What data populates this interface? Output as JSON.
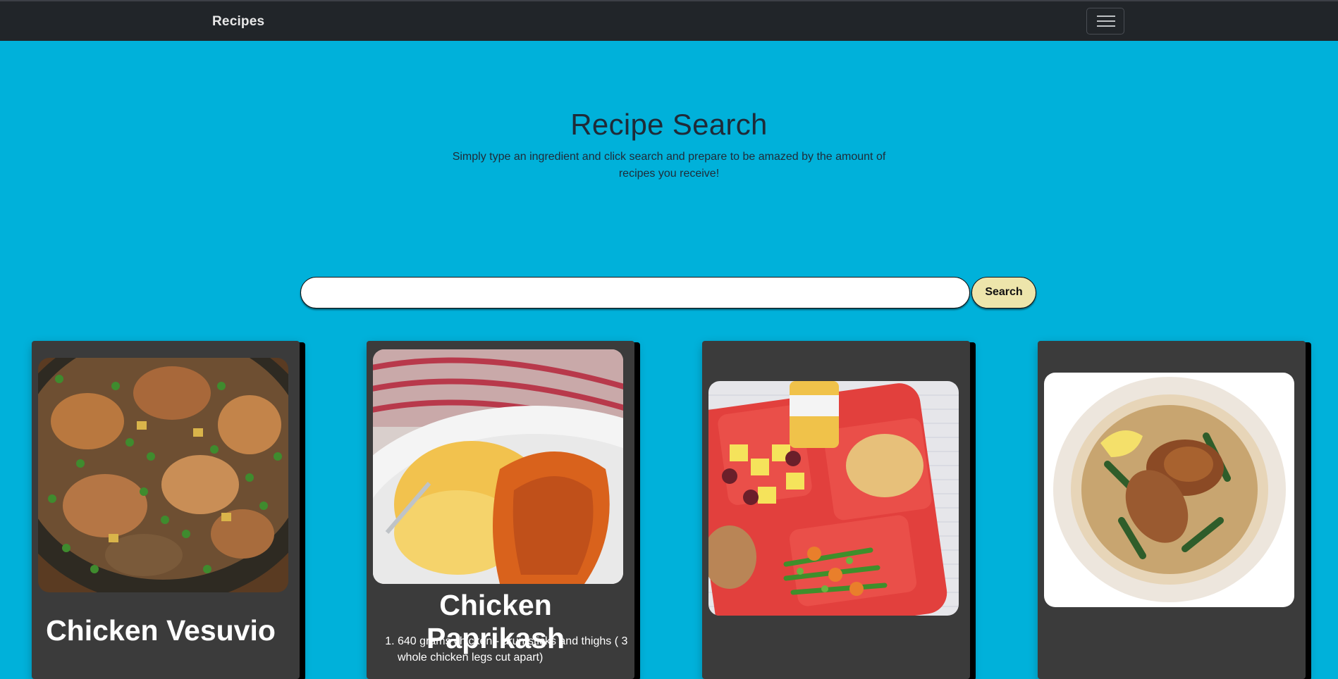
{
  "navbar": {
    "brand": "Recipes",
    "menu_icon": "hamburger-menu-icon"
  },
  "hero": {
    "title": "Recipe Search",
    "subtitle": "Simply type an ingredient and click search and prepare to be amazed by the amount of recipes you receive!"
  },
  "search": {
    "value": "",
    "placeholder": "",
    "button_label": "Search"
  },
  "recipes": [
    {
      "title": "Chicken Vesuvio",
      "image": "chicken-vesuvio-photo",
      "ingredients": []
    },
    {
      "title": "Chicken Paprikash",
      "image": "chicken-paprikash-photo",
      "ingredients": [
        "640 grams chicken - drumsticks and thighs ( 3 whole chicken legs cut apart)"
      ]
    },
    {
      "title": "",
      "image": "school-lunch-tray-photo",
      "ingredients": []
    },
    {
      "title": "",
      "image": "chicken-in-broth-bowl-photo",
      "ingredients": []
    }
  ],
  "colors": {
    "background": "#00b1da",
    "navbar": "#212529",
    "card": "#3b3b3b",
    "search_button": "#ede5ab"
  }
}
